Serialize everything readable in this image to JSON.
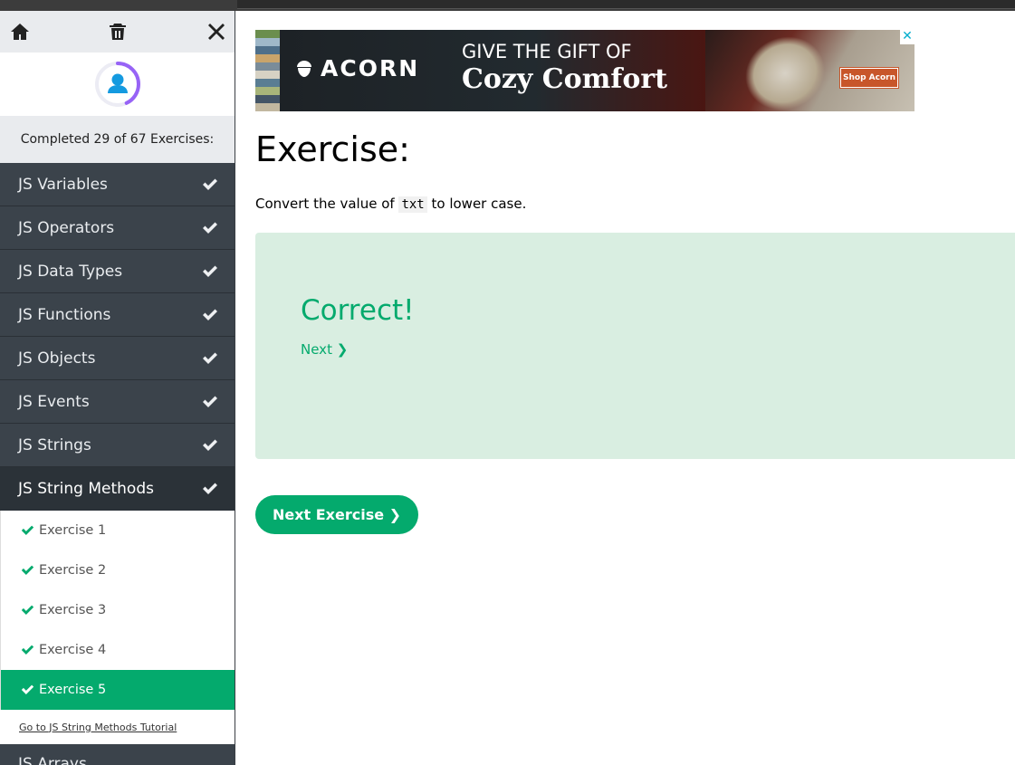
{
  "sidebar": {
    "progress_text": "Completed 29 of 67 Exercises:",
    "topics": [
      {
        "label": "JS Variables"
      },
      {
        "label": "JS Operators"
      },
      {
        "label": "JS Data Types"
      },
      {
        "label": "JS Functions"
      },
      {
        "label": "JS Objects"
      },
      {
        "label": "JS Events"
      },
      {
        "label": "JS Strings"
      },
      {
        "label": "JS String Methods"
      }
    ],
    "exercises": [
      {
        "label": "Exercise 1"
      },
      {
        "label": "Exercise 2"
      },
      {
        "label": "Exercise 3"
      },
      {
        "label": "Exercise 4"
      },
      {
        "label": "Exercise 5"
      }
    ],
    "tutorial_link": "Go to JS String Methods Tutorial",
    "next_topic": "JS Arrays",
    "progress_fraction": 0.43
  },
  "ad": {
    "brand": "ACORN",
    "headline": "GIVE THE GIFT OF",
    "subheadline": "Cozy Comfort",
    "cta": "Shop Acorn",
    "close": "✕"
  },
  "main": {
    "title": "Exercise:",
    "desc_prefix": "Convert the value of ",
    "desc_code": "txt",
    "desc_suffix": " to lower case.",
    "result_text": "Correct!",
    "next_link": "Next ❯",
    "next_exercise_button": "Next Exercise ❯"
  },
  "colors": {
    "accent": "#04aa6d",
    "sidebar_dark": "#3b434b",
    "result_bg": "#d9eee1"
  }
}
